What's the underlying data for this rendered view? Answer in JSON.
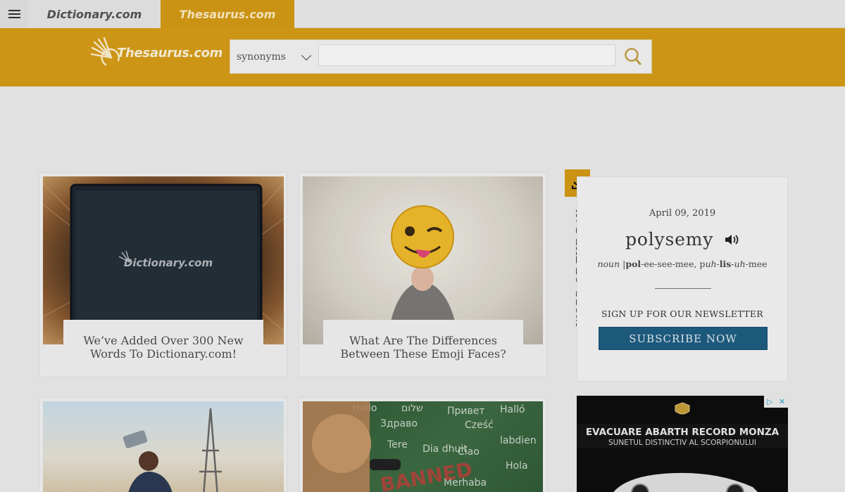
{
  "topbar": {
    "dictionary_tab": "Dictionary.com",
    "thesaurus_tab": "Thesaurus.com"
  },
  "header": {
    "logo_text": "Thesaurus.com",
    "search_select": "synonyms",
    "search_value": ""
  },
  "cards": [
    {
      "caption": "We’ve Added Over 300 New Words To Dictionary.com!",
      "image_text": "Dictionary.com"
    },
    {
      "caption": "What Are The Differences Between These Emoji Faces?"
    },
    {
      "caption": ""
    },
    {
      "caption": ""
    }
  ],
  "wotd": {
    "label": "WORD OF THE DAY",
    "date": "April 09, 2019",
    "word": "polysemy",
    "pos": "noun",
    "pron_sep": "|",
    "pron_parts": [
      "pol",
      "-ee-see-mee, p",
      "uh",
      "-",
      "lis",
      "-",
      "uh",
      "-mee"
    ],
    "newsletter": "SIGN UP FOR OUR NEWSLETTER",
    "subscribe": "SUBSCRIBE NOW"
  },
  "ad": {
    "headline": "EVACUARE ABARTH RECORD MONZA",
    "subline": "SUNETUL DISTINCTIV AL SCORPIONULUI",
    "choices_icon": "ad-choices-icon",
    "close_icon": "close-icon"
  },
  "colors": {
    "brand": "#d99f17",
    "subscribe": "#1f5f83"
  }
}
